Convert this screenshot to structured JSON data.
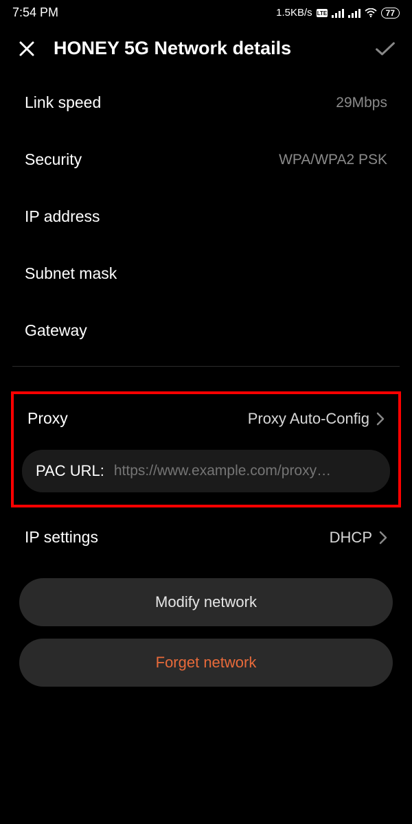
{
  "status": {
    "time": "7:54 PM",
    "speed": "1.5KB/s",
    "battery": "77"
  },
  "header": {
    "title": "HONEY 5G Network details"
  },
  "details": {
    "link_speed_label": "Link speed",
    "link_speed_value": "29Mbps",
    "security_label": "Security",
    "security_value": "WPA/WPA2 PSK",
    "ip_address_label": "IP address",
    "subnet_label": "Subnet mask",
    "gateway_label": "Gateway"
  },
  "proxy": {
    "label": "Proxy",
    "value": "Proxy Auto-Config",
    "pac_label": "PAC URL:",
    "pac_placeholder": "https://www.example.com/proxy…"
  },
  "ip_settings": {
    "label": "IP settings",
    "value": "DHCP"
  },
  "buttons": {
    "modify": "Modify network",
    "forget": "Forget network"
  }
}
